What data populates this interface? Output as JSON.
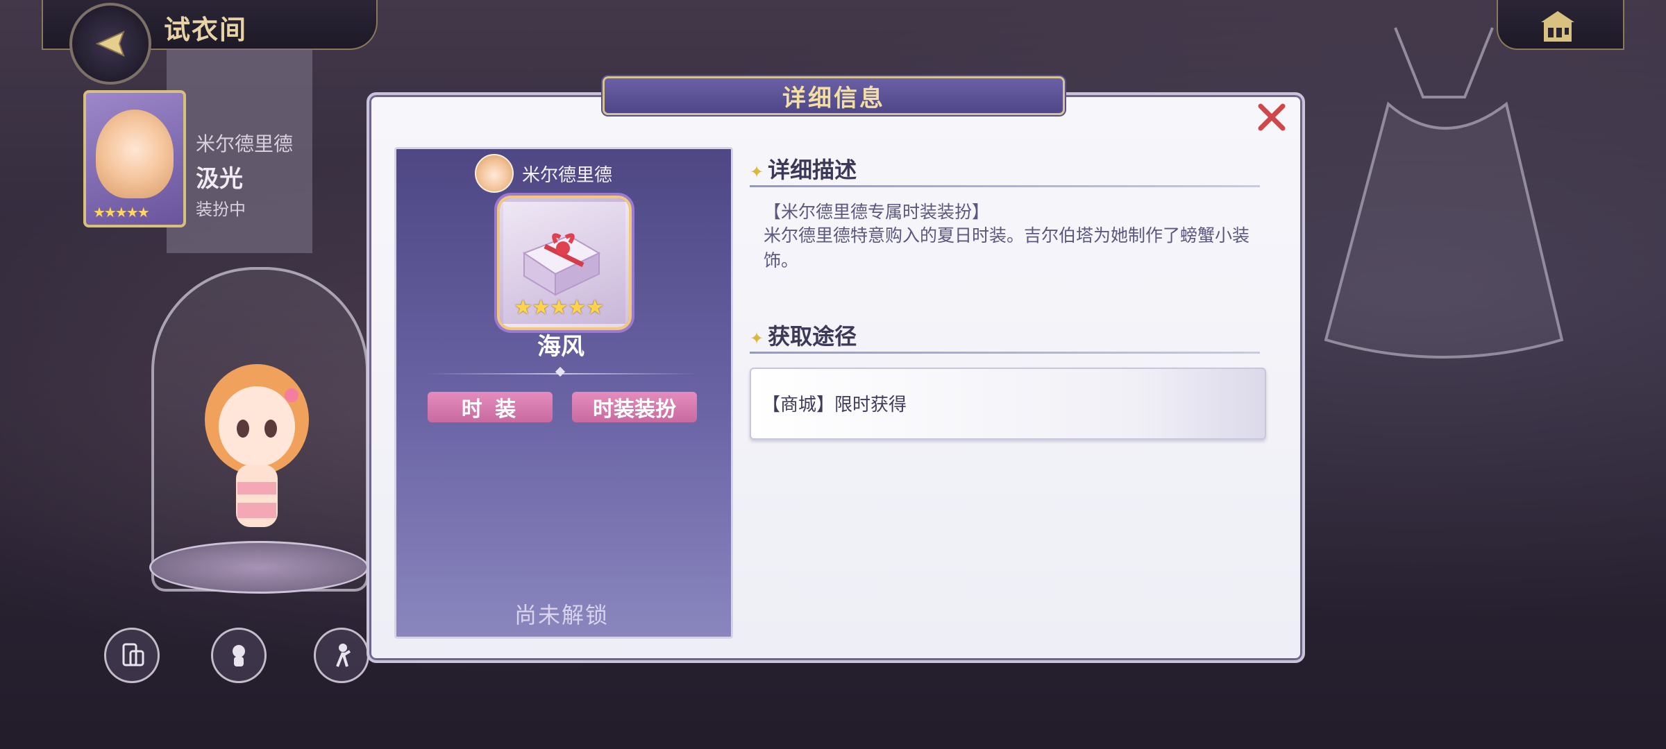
{
  "header": {
    "title": "试衣间"
  },
  "character": {
    "name_line1": "米尔德里德",
    "name_line2": "汲光",
    "status": "装扮中",
    "stars": "★★★★★"
  },
  "dialog": {
    "title": "详细信息",
    "owner_name": "米尔德里德",
    "item_name": "海风",
    "item_stars": "★★★★★",
    "tags": [
      "时 装",
      "时装装扮"
    ],
    "lock_status": "尚未解锁",
    "description": {
      "heading": "详细描述",
      "line1": "【米尔德里德专属时装装扮】",
      "line2": "米尔德里德特意购入的夏日时装。吉尔伯塔为她制作了螃蟹小装饰。"
    },
    "source": {
      "heading": "获取途径",
      "entry": "【商城】限时获得"
    }
  },
  "colors": {
    "dialog_title_bg": "#5a5196",
    "dialog_title_text": "#f3df9f",
    "tag_pink": "#d87aae",
    "close_red": "#d0474a"
  }
}
